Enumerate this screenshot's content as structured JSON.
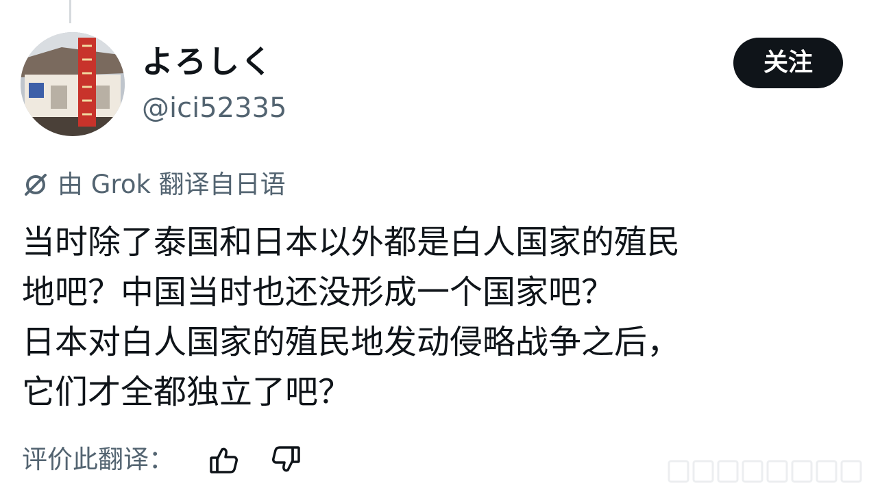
{
  "author": {
    "display_name": "よろしく",
    "handle": "@ici52335",
    "avatar": "avatar-photo"
  },
  "follow_button": {
    "label": "关注"
  },
  "translation": {
    "icon": "grok-icon",
    "note": "由 Grok 翻译自日语"
  },
  "tweet": {
    "lines": [
      "当时除了泰国和日本以外都是白人国家的殖民",
      "地吧？中国当时也还没形成一个国家吧？",
      "日本对白人国家的殖民地发动侵略战争之后，",
      "它们才全都独立了吧？"
    ]
  },
  "rating": {
    "label": "评价此翻译：",
    "like_icon": "thumbs-up-icon",
    "dislike_icon": "thumbs-down-icon"
  },
  "colors": {
    "text": "#0f1419",
    "secondary_text": "#536471",
    "button_bg": "#0f1419",
    "button_text": "#ffffff"
  }
}
